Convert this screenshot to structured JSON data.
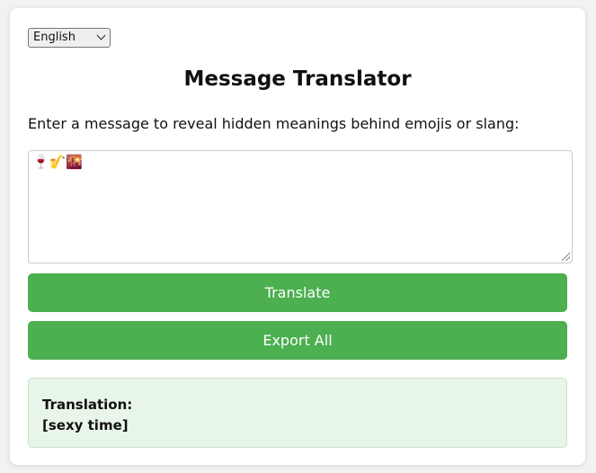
{
  "language_select": {
    "selected": "English"
  },
  "page": {
    "title": "Message Translator",
    "prompt": "Enter a message to reveal hidden meanings behind emojis or slang:"
  },
  "message_input": {
    "value": "🍷🎷🌇"
  },
  "buttons": {
    "translate_label": "Translate",
    "export_label": "Export All"
  },
  "result": {
    "heading": "Translation:",
    "text": "[sexy time]"
  },
  "colors": {
    "button_bg": "#4caf50",
    "result_bg": "#e8f5e9"
  }
}
